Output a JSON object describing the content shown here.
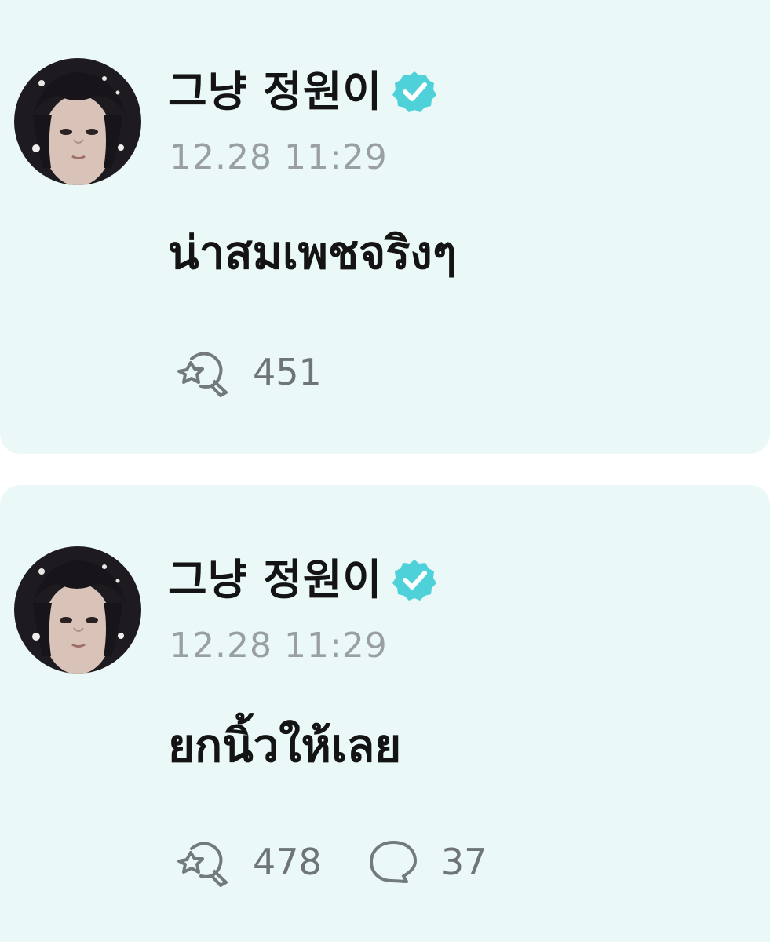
{
  "posts": [
    {
      "author": "그냥 정원이",
      "verified_icon": "verified-badge-icon",
      "timestamp": "12.28 11:29",
      "message": "น่าสมเพชจริงๆ",
      "reaction_icon": "heart-rocket-icon",
      "reaction_count": "451"
    },
    {
      "author": "그냥 정원이",
      "verified_icon": "verified-badge-icon",
      "timestamp": "12.28 11:29",
      "message": "ยกนิ้วให้เลย",
      "reaction_icon": "heart-rocket-icon",
      "reaction_count": "478",
      "comment_icon": "comment-bubble-icon",
      "comment_count": "37"
    }
  ],
  "colors": {
    "card_background": "#eaf8f8",
    "verified_badge": "#4fd1d9",
    "text_primary": "#141414",
    "text_secondary": "#9a9fa1",
    "action_text": "#6f7577"
  }
}
